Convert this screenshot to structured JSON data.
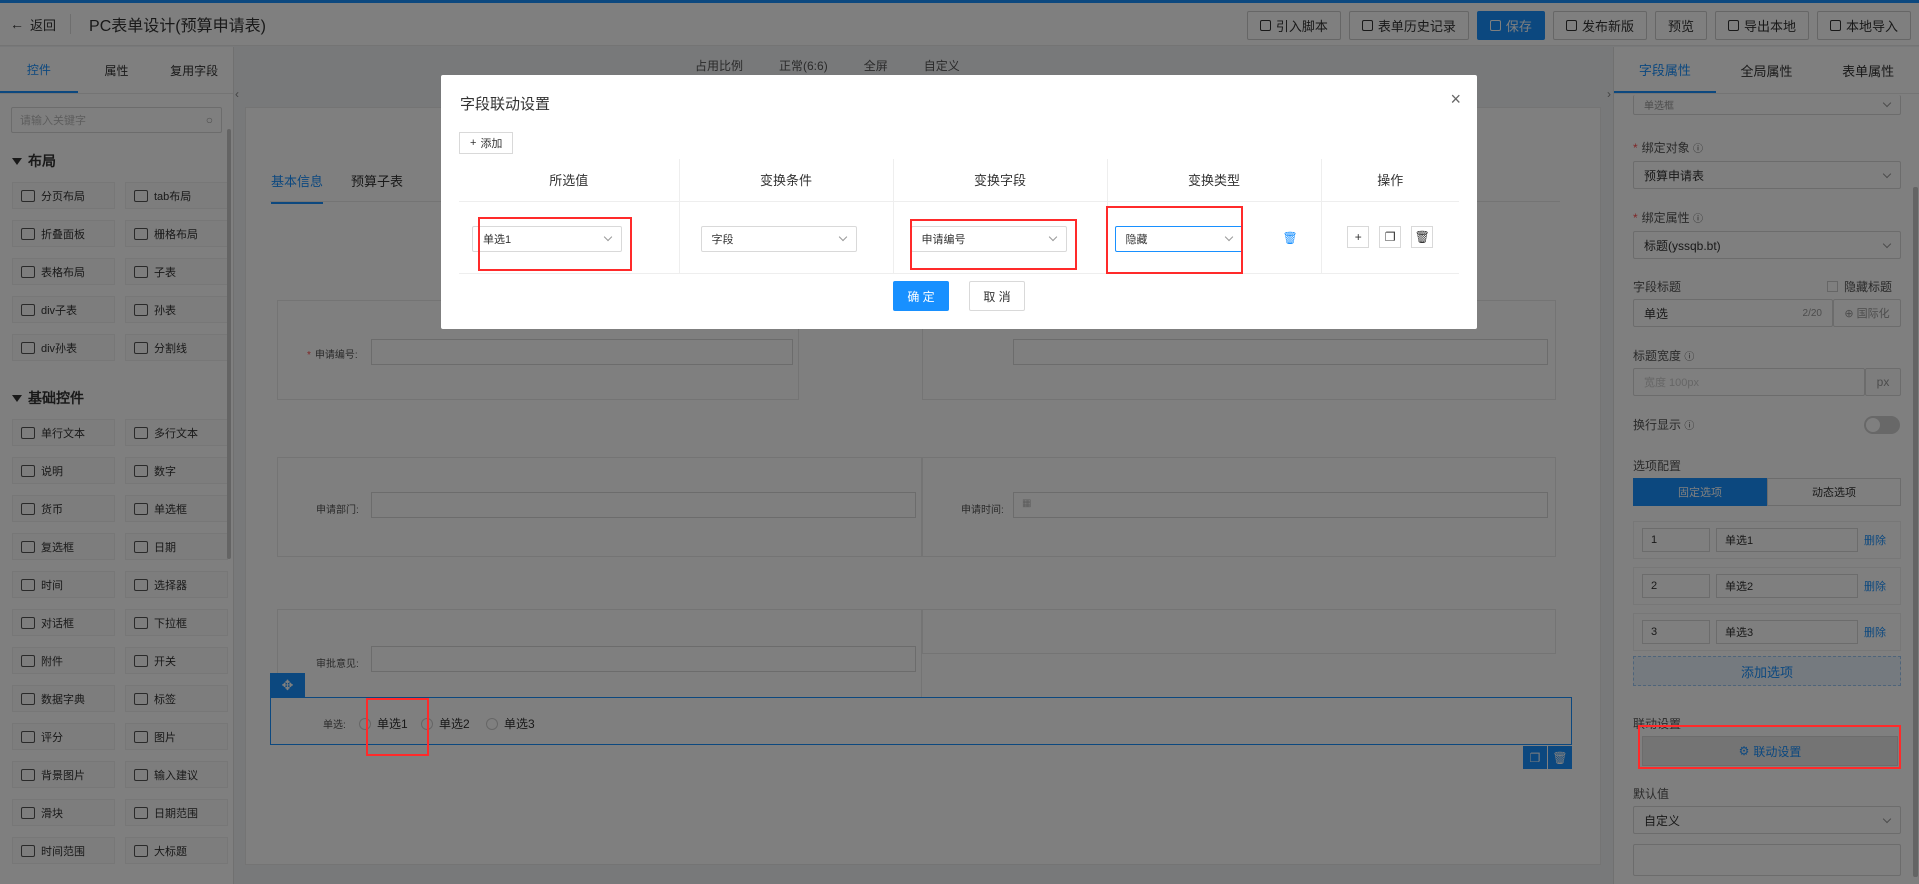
{
  "header": {
    "back_label": "返回",
    "title": "PC表单设计(预算申请表)",
    "toolbar": [
      {
        "label": "引入脚本",
        "icon": "script-icon",
        "primary": false
      },
      {
        "label": "表单历史记录",
        "icon": "history-icon",
        "primary": false
      },
      {
        "label": "保存",
        "icon": "save-icon",
        "primary": true
      },
      {
        "label": "发布新版",
        "icon": "publish-icon",
        "primary": false
      },
      {
        "label": "预览",
        "icon": "",
        "primary": false
      },
      {
        "label": "导出本地",
        "icon": "export-icon",
        "primary": false
      },
      {
        "label": "本地导入",
        "icon": "import-icon",
        "primary": false
      }
    ]
  },
  "left_panel": {
    "tabs": [
      "控件",
      "属性",
      "复用字段"
    ],
    "search_placeholder": "请输入关键字",
    "sections": [
      {
        "title": "布局",
        "items": [
          "分页布局",
          "tab布局",
          "折叠面板",
          "栅格布局",
          "表格布局",
          "子表",
          "div子表",
          "孙表",
          "div孙表",
          "分割线"
        ]
      },
      {
        "title": "基础控件",
        "items": [
          "单行文本",
          "多行文本",
          "说明",
          "数字",
          "货币",
          "单选框",
          "复选框",
          "日期",
          "时间",
          "选择器",
          "对话框",
          "下拉框",
          "附件",
          "开关",
          "数据字典",
          "标签",
          "评分",
          "图片",
          "背景图片",
          "输入建议",
          "滑块",
          "日期范围",
          "时间范围",
          "大标题"
        ]
      }
    ]
  },
  "canvas": {
    "top_options": [
      "占用比例",
      "正常(6:6)",
      "全屏",
      "自定义"
    ],
    "form_tabs": [
      "基本信息",
      "预算子表"
    ],
    "fields": {
      "apply_no": "申请编号:",
      "apply_dept": "申请部门:",
      "apply_time": "申请时间:",
      "approval": "审批意见:",
      "radio_label": "单选:"
    },
    "radio_options": [
      "单选1",
      "单选2",
      "单选3"
    ]
  },
  "right_panel": {
    "tabs": [
      "字段属性",
      "全局属性",
      "表单属性"
    ],
    "top_select": "单选框",
    "bind_object_label": "绑定对象",
    "bind_object_value": "预算申请表",
    "bind_attr_label": "绑定属性",
    "bind_attr_value": "标题(yssqb.bt)",
    "field_title_label": "字段标题",
    "hide_title_label": "隐藏标题",
    "field_title_value": "单选",
    "field_title_count": "2/20",
    "intl_label": "国际化",
    "title_width_label": "标题宽度",
    "title_width_placeholder": "宽度   100px",
    "title_width_unit": "px",
    "wrap_label": "换行显示",
    "options_config_label": "选项配置",
    "fixed_options": "固定选项",
    "dynamic_options": "动态选项",
    "options": [
      {
        "key": "1",
        "value": "单选1"
      },
      {
        "key": "2",
        "value": "单选2"
      },
      {
        "key": "3",
        "value": "单选3"
      }
    ],
    "delete_label": "删除",
    "add_option": "添加选项",
    "linkage_label": "联动设置",
    "linkage_button": "联动设置",
    "default_label": "默认值",
    "default_value": "自定义"
  },
  "modal": {
    "title": "字段联动设置",
    "add_label": "添加",
    "columns": [
      "所选值",
      "变换条件",
      "变换字段",
      "变换类型",
      "操作"
    ],
    "row": {
      "selected_value": "单选1",
      "condition": "字段",
      "field": "申请编号",
      "type": "隐藏"
    },
    "ok": "确 定",
    "cancel": "取 消"
  },
  "colors": {
    "primary": "#1890ff",
    "highlight": "#ff2a2a"
  }
}
